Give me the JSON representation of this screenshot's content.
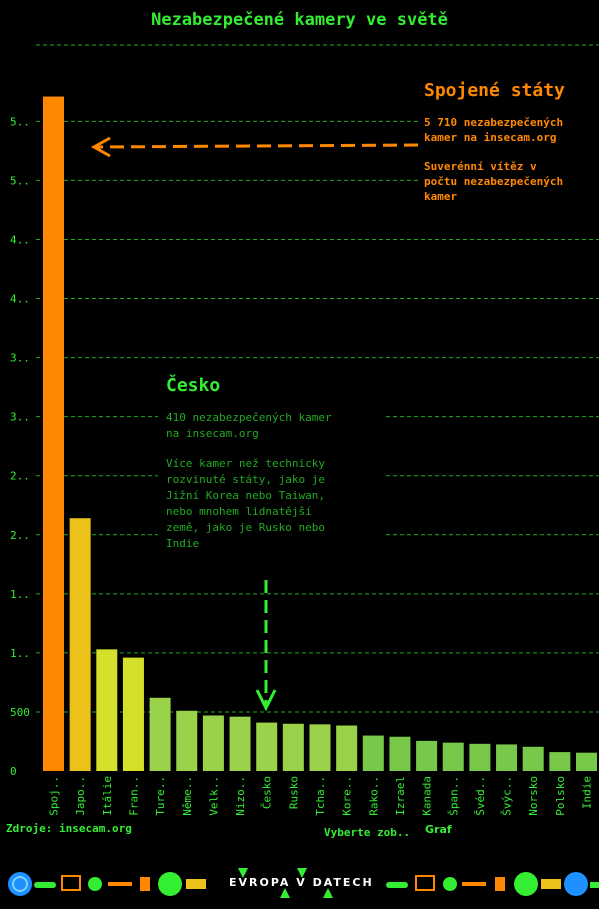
{
  "title": "Nezabezpečené kamery ve světě",
  "annotations": {
    "us": {
      "heading": "Spojené státy",
      "text1_l1": "5 710 nezabezpečených",
      "text1_l2": "kamer na insecam.org",
      "text2_l1": "Suverénní vítěz v",
      "text2_l2": "počtu nezabezpečených",
      "text2_l3": "kamer"
    },
    "cz": {
      "heading": "Česko",
      "text1_l1": "410 nezabezpečených kamer",
      "text1_l2": "na insecam.org",
      "text2_l1": "Více kamer než technicky",
      "text2_l2": "rozvinuté státy, jako je",
      "text2_l3": "Jižní Korea nebo Taiwan,",
      "text2_l4": "nebo mnohem lidnatější",
      "text2_l5": "země, jako je Rusko nebo",
      "text2_l6": "Indie"
    }
  },
  "footer": {
    "source": "Zdroje: insecam.org",
    "select_label": "Vyberte zob..",
    "select_value": "Graf",
    "brand": "EVROPA V DATECH"
  },
  "colors": {
    "accent_us": "#ff8800",
    "accent_green": "#33ee33",
    "grid": "#22aa22"
  },
  "chart_data": {
    "type": "bar",
    "title": "Nezabezpečené kamery ve světě",
    "categories": [
      "Spoj..",
      "Japo..",
      "Itálie",
      "Fran..",
      "Ture..",
      "Něme..",
      "Velk..",
      "Nizo..",
      "Česko",
      "Rusko",
      "Tcha..",
      "Kore..",
      "Rako..",
      "Izrael",
      "Kanada",
      "Špan..",
      "Švéd..",
      "Švýc..",
      "Norsko",
      "Polsko",
      "Indie"
    ],
    "values": [
      5710,
      2140,
      1030,
      960,
      620,
      510,
      470,
      460,
      410,
      400,
      395,
      385,
      300,
      290,
      255,
      240,
      230,
      225,
      205,
      160,
      155
    ],
    "bar_colors": [
      "#ff8800",
      "#ecc21a",
      "#d4e02a",
      "#d4e02a",
      "#9ad24a",
      "#9ad24a",
      "#9ad24a",
      "#9ad24a",
      "#9ad24a",
      "#9ad24a",
      "#9ad24a",
      "#9ad24a",
      "#78c84a",
      "#78c84a",
      "#78c84a",
      "#78c84a",
      "#78c84a",
      "#78c84a",
      "#78c84a",
      "#78c84a",
      "#78c84a"
    ],
    "y_tick_labels": [
      "0",
      "500",
      "1..",
      "1..",
      "2..",
      "2..",
      "3..",
      "3..",
      "4..",
      "4..",
      "5..",
      "5.."
    ],
    "y_tick_values": [
      0,
      500,
      1000,
      1500,
      2000,
      2500,
      3000,
      3500,
      4000,
      4500,
      5000,
      5500
    ],
    "ylim": [
      0,
      5850
    ],
    "grid": true,
    "xlabel": "",
    "ylabel": ""
  }
}
